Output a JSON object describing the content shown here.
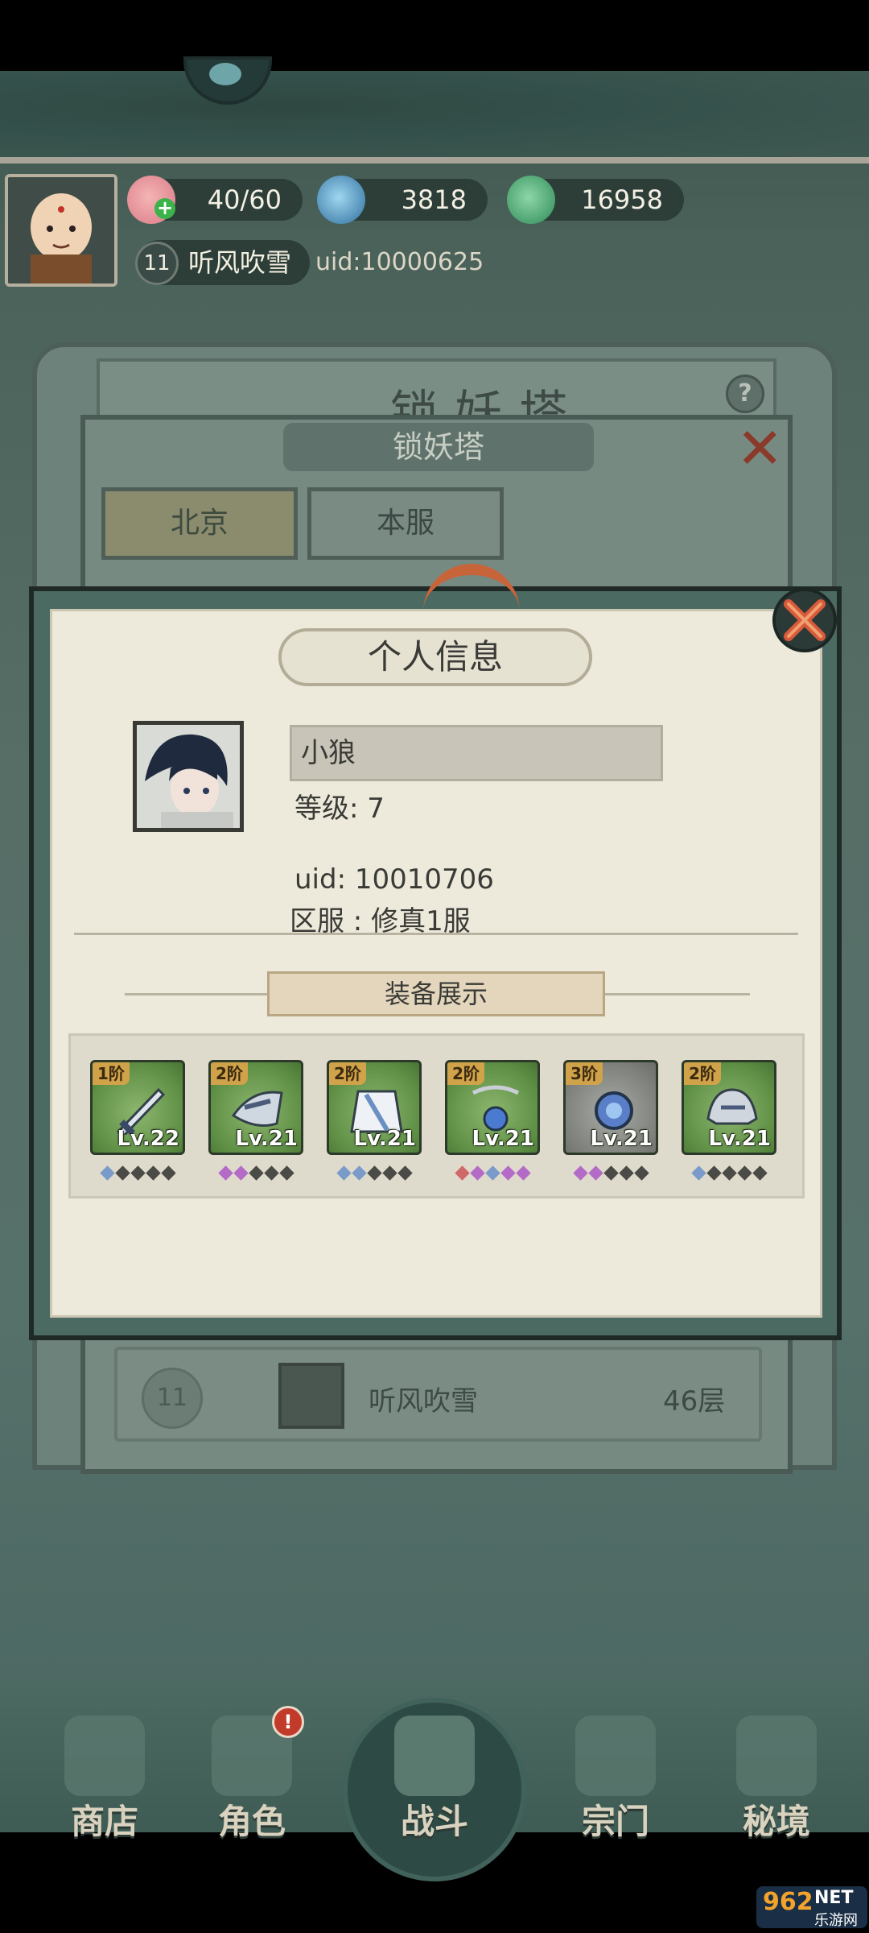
{
  "header": {
    "stamina": "40/60",
    "currency_1": "3818",
    "currency_2": "16958",
    "player_level": "11",
    "player_name": "听风吹雪",
    "player_uid": "uid:10000625"
  },
  "tower": {
    "banner_text": "锁妖塔",
    "title": "锁妖塔",
    "tabs": [
      "北京",
      "本服"
    ],
    "active_tab": 0,
    "rank_row": {
      "rank": "11",
      "name": "听风吹雪",
      "floor": "46层"
    }
  },
  "modal": {
    "title": "个人信息",
    "name": "小狼",
    "level_line": "等级:  7",
    "uid_line": "uid:  10010706",
    "server_line": "区服 : 修真1服",
    "equip_title": "装备展示",
    "equipment": [
      {
        "tier": "1阶",
        "level": "Lv.22",
        "item": "sword",
        "quality": "green",
        "gems": [
          "#7a9bc9",
          "#4a4a46",
          "#4a4a46",
          "#4a4a46",
          "#4a4a46"
        ]
      },
      {
        "tier": "2阶",
        "level": "Lv.21",
        "item": "shoulder-armor",
        "quality": "green",
        "gems": [
          "#b46ac7",
          "#b46ac7",
          "#4a4a46",
          "#4a4a46",
          "#4a4a46"
        ]
      },
      {
        "tier": "2阶",
        "level": "Lv.21",
        "item": "robe",
        "quality": "green",
        "gems": [
          "#7a9bc9",
          "#7a9bc9",
          "#4a4a46",
          "#4a4a46",
          "#4a4a46"
        ]
      },
      {
        "tier": "2阶",
        "level": "Lv.21",
        "item": "pendant",
        "quality": "green",
        "gems": [
          "#d06a6a",
          "#b46ac7",
          "#7a9bc9",
          "#b46ac7",
          "#b46ac7"
        ]
      },
      {
        "tier": "3阶",
        "level": "Lv.21",
        "item": "ring",
        "quality": "gray",
        "gems": [
          "#b46ac7",
          "#b46ac7",
          "#4a4a46",
          "#4a4a46",
          "#4a4a46"
        ]
      },
      {
        "tier": "2阶",
        "level": "Lv.21",
        "item": "helmet",
        "quality": "green",
        "gems": [
          "#7a9bc9",
          "#4a4a46",
          "#4a4a46",
          "#4a4a46",
          "#4a4a46"
        ]
      }
    ]
  },
  "nav": {
    "items": [
      "商店",
      "角色",
      "战斗",
      "宗门",
      "秘境"
    ],
    "badge": "!"
  },
  "watermark": {
    "a": "962",
    "b": "NET",
    "c": "乐游网"
  },
  "colors": {
    "accent": "#d0a24a",
    "close": "#c84a34",
    "panel": "#edeadc"
  }
}
